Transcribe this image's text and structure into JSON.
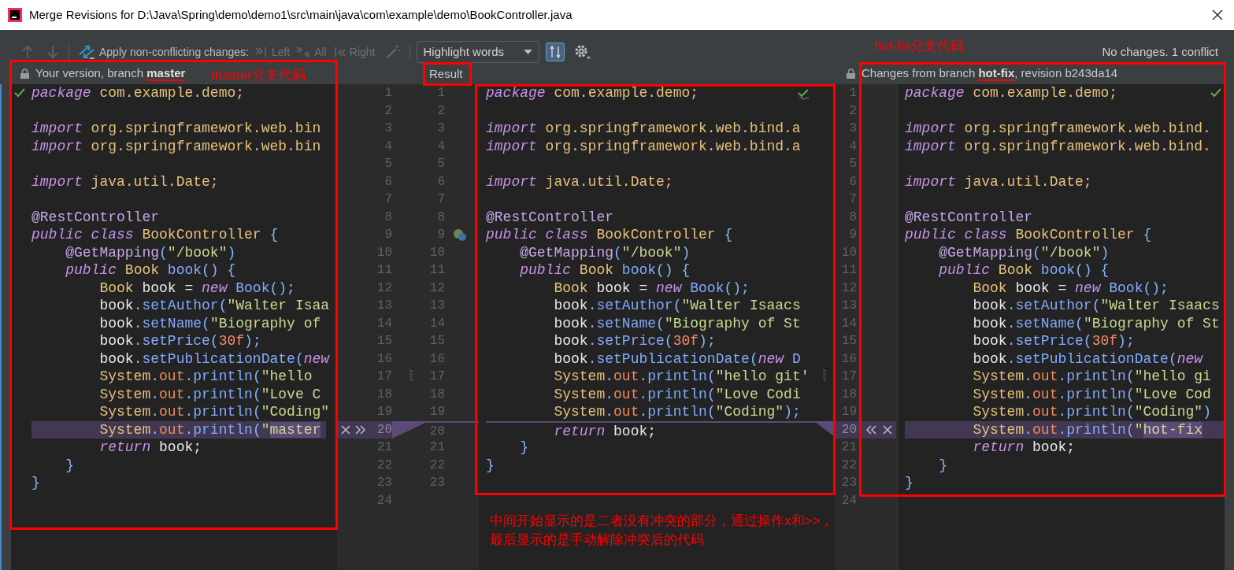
{
  "window": {
    "title": "Merge Revisions for D:\\Java\\Spring\\demo\\demo1\\src\\main\\java\\com\\example\\demo\\BookController.java"
  },
  "toolbar": {
    "apply_label": "Apply non-conflicting changes:",
    "apply_buttons": [
      {
        "label": "Left",
        "disabled": true
      },
      {
        "label": "All",
        "disabled": true
      },
      {
        "label": "Right",
        "disabled": true
      }
    ],
    "highlight_mode": "Highlight words",
    "sync_scroll_on": true,
    "status": "No changes. 1 conflict"
  },
  "left_pane": {
    "header": "Your version, branch **master**",
    "locked": true,
    "lines": [
      {
        "kind": "code",
        "segments": [
          {
            "kind": "kw",
            "text": "package"
          },
          {
            "kind": "type",
            "text": " com.example.demo;"
          }
        ]
      },
      {
        "kind": "blank"
      },
      {
        "kind": "code",
        "segments": [
          {
            "kind": "kw",
            "text": "import"
          },
          {
            "kind": "type",
            "text": " org.springframework.web.bin"
          }
        ]
      },
      {
        "kind": "code",
        "segments": [
          {
            "kind": "kw",
            "text": "import"
          },
          {
            "kind": "type",
            "text": " org.springframework.web.bin"
          }
        ]
      },
      {
        "kind": "blank"
      },
      {
        "kind": "code",
        "segments": [
          {
            "kind": "kw",
            "text": "import"
          },
          {
            "kind": "type",
            "text": " java.util.Date;"
          }
        ]
      },
      {
        "kind": "blank"
      },
      {
        "kind": "code",
        "segments": [
          {
            "kind": "anno",
            "text": "@RestController"
          }
        ]
      },
      {
        "kind": "code",
        "segments": [
          {
            "kind": "kw",
            "text": "public class"
          },
          {
            "kind": "type",
            "text": " BookController "
          },
          {
            "kind": "punct",
            "text": "{"
          }
        ]
      },
      {
        "kind": "code",
        "segments": [
          {
            "kind": "anno",
            "text": "    @GetMapping"
          },
          {
            "kind": "punct",
            "text": "("
          },
          {
            "kind": "str",
            "text": "\"/book\""
          },
          {
            "kind": "punct",
            "text": ")"
          }
        ]
      },
      {
        "kind": "code",
        "segments": [
          {
            "kind": "kw",
            "text": "    public"
          },
          {
            "kind": "type",
            "text": " Book "
          },
          {
            "kind": "method",
            "text": "book"
          },
          {
            "kind": "punct",
            "text": "() {"
          }
        ]
      },
      {
        "kind": "code",
        "segments": [
          {
            "kind": "type",
            "text": "        Book"
          },
          {
            "kind": "var",
            "text": " book = "
          },
          {
            "kind": "kw",
            "text": "new"
          },
          {
            "kind": "method",
            "text": " Book"
          },
          {
            "kind": "punct",
            "text": "();"
          }
        ]
      },
      {
        "kind": "code",
        "segments": [
          {
            "kind": "var",
            "text": "        book"
          },
          {
            "kind": "punct",
            "text": "."
          },
          {
            "kind": "method",
            "text": "setAuthor"
          },
          {
            "kind": "punct",
            "text": "("
          },
          {
            "kind": "str",
            "text": "\"Walter Isaa"
          }
        ]
      },
      {
        "kind": "code",
        "segments": [
          {
            "kind": "var",
            "text": "        book"
          },
          {
            "kind": "punct",
            "text": "."
          },
          {
            "kind": "method",
            "text": "setName"
          },
          {
            "kind": "punct",
            "text": "("
          },
          {
            "kind": "str",
            "text": "\"Biography of"
          }
        ]
      },
      {
        "kind": "code",
        "segments": [
          {
            "kind": "var",
            "text": "        book"
          },
          {
            "kind": "punct",
            "text": "."
          },
          {
            "kind": "method",
            "text": "setPrice"
          },
          {
            "kind": "punct",
            "text": "("
          },
          {
            "kind": "num",
            "text": "30f"
          },
          {
            "kind": "punct",
            "text": ");"
          }
        ]
      },
      {
        "kind": "code",
        "segments": [
          {
            "kind": "var",
            "text": "        book"
          },
          {
            "kind": "punct",
            "text": "."
          },
          {
            "kind": "method",
            "text": "setPublicationDate"
          },
          {
            "kind": "punct",
            "text": "("
          },
          {
            "kind": "kw",
            "text": "new"
          }
        ]
      },
      {
        "kind": "code",
        "segments": [
          {
            "kind": "type",
            "text": "        System"
          },
          {
            "kind": "punct",
            "text": "."
          },
          {
            "kind": "field",
            "text": "out"
          },
          {
            "kind": "punct",
            "text": "."
          },
          {
            "kind": "method",
            "text": "println"
          },
          {
            "kind": "punct",
            "text": "("
          },
          {
            "kind": "str",
            "text": "\"hello"
          }
        ]
      },
      {
        "kind": "code",
        "segments": [
          {
            "kind": "type",
            "text": "        System"
          },
          {
            "kind": "punct",
            "text": "."
          },
          {
            "kind": "field",
            "text": "out"
          },
          {
            "kind": "punct",
            "text": "."
          },
          {
            "kind": "method",
            "text": "println"
          },
          {
            "kind": "punct",
            "text": "("
          },
          {
            "kind": "str",
            "text": "\"Love C"
          }
        ]
      },
      {
        "kind": "code",
        "segments": [
          {
            "kind": "type",
            "text": "        System"
          },
          {
            "kind": "punct",
            "text": "."
          },
          {
            "kind": "field",
            "text": "out"
          },
          {
            "kind": "punct",
            "text": "."
          },
          {
            "kind": "method",
            "text": "println"
          },
          {
            "kind": "punct",
            "text": "("
          },
          {
            "kind": "str",
            "text": "\"Coding\""
          }
        ]
      },
      {
        "kind": "conflict",
        "segments": [
          {
            "kind": "type",
            "text": "        System"
          },
          {
            "kind": "punct",
            "text": "."
          },
          {
            "kind": "field",
            "text": "out"
          },
          {
            "kind": "punct",
            "text": "."
          },
          {
            "kind": "method",
            "text": "println"
          },
          {
            "kind": "punct",
            "text": "("
          },
          {
            "kind": "str",
            "text": "\""
          },
          {
            "kind": "hl",
            "text": "master"
          }
        ]
      },
      {
        "kind": "code",
        "segments": [
          {
            "kind": "kw",
            "text": "        return"
          },
          {
            "kind": "var",
            "text": " book;"
          }
        ]
      },
      {
        "kind": "code",
        "segments": [
          {
            "kind": "punct",
            "text": "    }"
          }
        ]
      },
      {
        "kind": "code",
        "segments": [
          {
            "kind": "punct",
            "text": "}"
          }
        ]
      }
    ]
  },
  "result_pane": {
    "header": "Result",
    "lines": [
      {
        "kind": "code",
        "segments": [
          {
            "kind": "kw",
            "text": "package"
          },
          {
            "kind": "type",
            "text": " com.example.demo;"
          }
        ]
      },
      {
        "kind": "blank"
      },
      {
        "kind": "code",
        "segments": [
          {
            "kind": "kw",
            "text": "import"
          },
          {
            "kind": "type",
            "text": " org.springframework.web.bind.a"
          }
        ]
      },
      {
        "kind": "code",
        "segments": [
          {
            "kind": "kw",
            "text": "import"
          },
          {
            "kind": "type",
            "text": " org.springframework.web.bind.a"
          }
        ]
      },
      {
        "kind": "blank"
      },
      {
        "kind": "code",
        "segments": [
          {
            "kind": "kw",
            "text": "import"
          },
          {
            "kind": "type",
            "text": " java.util.Date;"
          }
        ]
      },
      {
        "kind": "blank"
      },
      {
        "kind": "code",
        "segments": [
          {
            "kind": "anno",
            "text": "@RestController"
          }
        ]
      },
      {
        "kind": "code",
        "segments": [
          {
            "kind": "kw",
            "text": "public class"
          },
          {
            "kind": "type",
            "text": " BookController "
          },
          {
            "kind": "punct",
            "text": "{"
          }
        ]
      },
      {
        "kind": "code",
        "segments": [
          {
            "kind": "anno",
            "text": "    @GetMapping"
          },
          {
            "kind": "punct",
            "text": "("
          },
          {
            "kind": "str",
            "text": "\"/book\""
          },
          {
            "kind": "punct",
            "text": ")"
          }
        ]
      },
      {
        "kind": "code",
        "segments": [
          {
            "kind": "kw",
            "text": "    public"
          },
          {
            "kind": "type",
            "text": " Book "
          },
          {
            "kind": "method",
            "text": "book"
          },
          {
            "kind": "punct",
            "text": "() {"
          }
        ]
      },
      {
        "kind": "code",
        "segments": [
          {
            "kind": "type",
            "text": "        Book"
          },
          {
            "kind": "var",
            "text": " book = "
          },
          {
            "kind": "kw",
            "text": "new"
          },
          {
            "kind": "method",
            "text": " Book"
          },
          {
            "kind": "punct",
            "text": "();"
          }
        ]
      },
      {
        "kind": "code",
        "segments": [
          {
            "kind": "var",
            "text": "        book"
          },
          {
            "kind": "punct",
            "text": "."
          },
          {
            "kind": "method",
            "text": "setAuthor"
          },
          {
            "kind": "punct",
            "text": "("
          },
          {
            "kind": "str",
            "text": "\"Walter Isaacs"
          }
        ]
      },
      {
        "kind": "code",
        "segments": [
          {
            "kind": "var",
            "text": "        book"
          },
          {
            "kind": "punct",
            "text": "."
          },
          {
            "kind": "method",
            "text": "setName"
          },
          {
            "kind": "punct",
            "text": "("
          },
          {
            "kind": "str",
            "text": "\"Biography of St"
          }
        ]
      },
      {
        "kind": "code",
        "segments": [
          {
            "kind": "var",
            "text": "        book"
          },
          {
            "kind": "punct",
            "text": "."
          },
          {
            "kind": "method",
            "text": "setPrice"
          },
          {
            "kind": "punct",
            "text": "("
          },
          {
            "kind": "num",
            "text": "30f"
          },
          {
            "kind": "punct",
            "text": ");"
          }
        ]
      },
      {
        "kind": "code",
        "segments": [
          {
            "kind": "var",
            "text": "        book"
          },
          {
            "kind": "punct",
            "text": "."
          },
          {
            "kind": "method",
            "text": "setPublicationDate"
          },
          {
            "kind": "punct",
            "text": "("
          },
          {
            "kind": "kw",
            "text": "new"
          },
          {
            "kind": "method",
            "text": " D"
          }
        ]
      },
      {
        "kind": "code",
        "segments": [
          {
            "kind": "type",
            "text": "        System"
          },
          {
            "kind": "punct",
            "text": "."
          },
          {
            "kind": "field",
            "text": "out"
          },
          {
            "kind": "punct",
            "text": "."
          },
          {
            "kind": "method",
            "text": "println"
          },
          {
            "kind": "punct",
            "text": "("
          },
          {
            "kind": "str",
            "text": "\"hello git'"
          }
        ]
      },
      {
        "kind": "code",
        "segments": [
          {
            "kind": "type",
            "text": "        System"
          },
          {
            "kind": "punct",
            "text": "."
          },
          {
            "kind": "field",
            "text": "out"
          },
          {
            "kind": "punct",
            "text": "."
          },
          {
            "kind": "method",
            "text": "println"
          },
          {
            "kind": "punct",
            "text": "("
          },
          {
            "kind": "str",
            "text": "\"Love Codi"
          }
        ]
      },
      {
        "kind": "code",
        "segments": [
          {
            "kind": "type",
            "text": "        System"
          },
          {
            "kind": "punct",
            "text": "."
          },
          {
            "kind": "field",
            "text": "out"
          },
          {
            "kind": "punct",
            "text": "."
          },
          {
            "kind": "method",
            "text": "println"
          },
          {
            "kind": "punct",
            "text": "("
          },
          {
            "kind": "str",
            "text": "\"Coding\""
          },
          {
            "kind": "punct",
            "text": ");"
          }
        ]
      },
      {
        "kind": "code",
        "segments": [
          {
            "kind": "kw",
            "text": "        return"
          },
          {
            "kind": "var",
            "text": " book;"
          }
        ]
      },
      {
        "kind": "code",
        "segments": [
          {
            "kind": "punct",
            "text": "    }"
          }
        ]
      },
      {
        "kind": "code",
        "segments": [
          {
            "kind": "punct",
            "text": "}"
          }
        ]
      }
    ]
  },
  "right_pane": {
    "header": "Changes from branch **hot-fix**, revision b243da14",
    "locked": true,
    "lines": [
      {
        "kind": "code",
        "segments": [
          {
            "kind": "kw",
            "text": "package"
          },
          {
            "kind": "type",
            "text": " com.example.demo;"
          }
        ]
      },
      {
        "kind": "blank"
      },
      {
        "kind": "code",
        "segments": [
          {
            "kind": "kw",
            "text": "import"
          },
          {
            "kind": "type",
            "text": " org.springframework.web.bind."
          }
        ]
      },
      {
        "kind": "code",
        "segments": [
          {
            "kind": "kw",
            "text": "import"
          },
          {
            "kind": "type",
            "text": " org.springframework.web.bind."
          }
        ]
      },
      {
        "kind": "blank"
      },
      {
        "kind": "code",
        "segments": [
          {
            "kind": "kw",
            "text": "import"
          },
          {
            "kind": "type",
            "text": " java.util.Date;"
          }
        ]
      },
      {
        "kind": "blank"
      },
      {
        "kind": "code",
        "segments": [
          {
            "kind": "anno",
            "text": "@RestController"
          }
        ]
      },
      {
        "kind": "code",
        "segments": [
          {
            "kind": "kw",
            "text": "public class"
          },
          {
            "kind": "type",
            "text": " BookController "
          },
          {
            "kind": "punct",
            "text": "{"
          }
        ]
      },
      {
        "kind": "code",
        "segments": [
          {
            "kind": "anno",
            "text": "    @GetMapping"
          },
          {
            "kind": "punct",
            "text": "("
          },
          {
            "kind": "str",
            "text": "\"/book\""
          },
          {
            "kind": "punct",
            "text": ")"
          }
        ]
      },
      {
        "kind": "code",
        "segments": [
          {
            "kind": "kw",
            "text": "    public"
          },
          {
            "kind": "type",
            "text": " Book "
          },
          {
            "kind": "method",
            "text": "book"
          },
          {
            "kind": "punct",
            "text": "() {"
          }
        ]
      },
      {
        "kind": "code",
        "segments": [
          {
            "kind": "type",
            "text": "        Book"
          },
          {
            "kind": "var",
            "text": " book = "
          },
          {
            "kind": "kw",
            "text": "new"
          },
          {
            "kind": "method",
            "text": " Book"
          },
          {
            "kind": "punct",
            "text": "();"
          }
        ]
      },
      {
        "kind": "code",
        "segments": [
          {
            "kind": "var",
            "text": "        book"
          },
          {
            "kind": "punct",
            "text": "."
          },
          {
            "kind": "method",
            "text": "setAuthor"
          },
          {
            "kind": "punct",
            "text": "("
          },
          {
            "kind": "str",
            "text": "\"Walter Isaacs"
          }
        ]
      },
      {
        "kind": "code",
        "segments": [
          {
            "kind": "var",
            "text": "        book"
          },
          {
            "kind": "punct",
            "text": "."
          },
          {
            "kind": "method",
            "text": "setName"
          },
          {
            "kind": "punct",
            "text": "("
          },
          {
            "kind": "str",
            "text": "\"Biography of St"
          }
        ]
      },
      {
        "kind": "code",
        "segments": [
          {
            "kind": "var",
            "text": "        book"
          },
          {
            "kind": "punct",
            "text": "."
          },
          {
            "kind": "method",
            "text": "setPrice"
          },
          {
            "kind": "punct",
            "text": "("
          },
          {
            "kind": "num",
            "text": "30f"
          },
          {
            "kind": "punct",
            "text": ");"
          }
        ]
      },
      {
        "kind": "code",
        "segments": [
          {
            "kind": "var",
            "text": "        book"
          },
          {
            "kind": "punct",
            "text": "."
          },
          {
            "kind": "method",
            "text": "setPublicationDate"
          },
          {
            "kind": "punct",
            "text": "("
          },
          {
            "kind": "kw",
            "text": "new"
          }
        ]
      },
      {
        "kind": "code",
        "segments": [
          {
            "kind": "type",
            "text": "        System"
          },
          {
            "kind": "punct",
            "text": "."
          },
          {
            "kind": "field",
            "text": "out"
          },
          {
            "kind": "punct",
            "text": "."
          },
          {
            "kind": "method",
            "text": "println"
          },
          {
            "kind": "punct",
            "text": "("
          },
          {
            "kind": "str",
            "text": "\"hello gi"
          }
        ]
      },
      {
        "kind": "code",
        "segments": [
          {
            "kind": "type",
            "text": "        System"
          },
          {
            "kind": "punct",
            "text": "."
          },
          {
            "kind": "field",
            "text": "out"
          },
          {
            "kind": "punct",
            "text": "."
          },
          {
            "kind": "method",
            "text": "println"
          },
          {
            "kind": "punct",
            "text": "("
          },
          {
            "kind": "str",
            "text": "\"Love Cod"
          }
        ]
      },
      {
        "kind": "code",
        "segments": [
          {
            "kind": "type",
            "text": "        System"
          },
          {
            "kind": "punct",
            "text": "."
          },
          {
            "kind": "field",
            "text": "out"
          },
          {
            "kind": "punct",
            "text": "."
          },
          {
            "kind": "method",
            "text": "println"
          },
          {
            "kind": "punct",
            "text": "("
          },
          {
            "kind": "str",
            "text": "\"Coding\""
          },
          {
            "kind": "punct",
            "text": ")"
          }
        ]
      },
      {
        "kind": "conflict",
        "segments": [
          {
            "kind": "type",
            "text": "        System"
          },
          {
            "kind": "punct",
            "text": "."
          },
          {
            "kind": "field",
            "text": "out"
          },
          {
            "kind": "punct",
            "text": "."
          },
          {
            "kind": "method",
            "text": "println"
          },
          {
            "kind": "punct",
            "text": "("
          },
          {
            "kind": "str",
            "text": "\""
          },
          {
            "kind": "hl",
            "text": "hot-fix"
          }
        ]
      },
      {
        "kind": "code",
        "segments": [
          {
            "kind": "kw",
            "text": "        return"
          },
          {
            "kind": "var",
            "text": " book;"
          }
        ]
      },
      {
        "kind": "code",
        "segments": [
          {
            "kind": "punct",
            "text": "    }"
          }
        ]
      },
      {
        "kind": "code",
        "segments": [
          {
            "kind": "punct",
            "text": "}"
          }
        ]
      }
    ]
  },
  "left_gutter": {
    "left_numbers": [
      "1",
      "2",
      "3",
      "4",
      "5",
      "6",
      "7",
      "8",
      "9",
      "10",
      "11",
      "12",
      "13",
      "14",
      "15",
      "16",
      "17",
      "18",
      "19",
      "20",
      "21",
      "22",
      "23",
      "24"
    ],
    "result_numbers": [
      "1",
      "2",
      "3",
      "4",
      "5",
      "6",
      "7",
      "8",
      "9",
      "10",
      "11",
      "12",
      "13",
      "14",
      "15",
      "16",
      "17",
      "18",
      "19",
      "20",
      "21",
      "22",
      "23"
    ]
  },
  "right_gutter": {
    "numbers": [
      "1",
      "2",
      "3",
      "4",
      "5",
      "6",
      "7",
      "8",
      "9",
      "10",
      "11",
      "12",
      "13",
      "14",
      "15",
      "16",
      "17",
      "18",
      "19",
      "20",
      "21",
      "22",
      "23",
      "24"
    ]
  },
  "annotations": [
    {
      "kind": "label",
      "text": "master分支代码"
    },
    {
      "kind": "label",
      "text": "hot-fix分支代码"
    },
    {
      "kind": "note",
      "text": "中间开始显示的是二者没有冲突的部分，通过操作x和>>，最后显示的是手动解除冲突后的代码"
    }
  ]
}
